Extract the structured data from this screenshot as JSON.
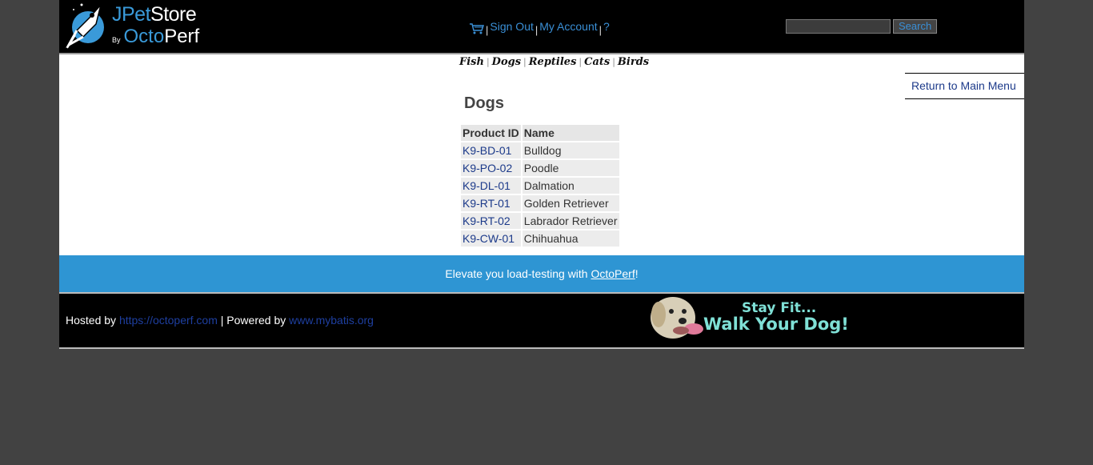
{
  "header": {
    "logo": {
      "word1_a": "JPet",
      "word1_b": "Store",
      "by": "By",
      "word2_a": "Octo",
      "word2_b": "Perf"
    },
    "menu": {
      "sign_out": "Sign Out",
      "my_account": "My Account",
      "help": "?",
      "separator": "|"
    },
    "search": {
      "value": "",
      "button": "Search"
    }
  },
  "quicklinks": [
    "Fish",
    "Dogs",
    "Reptiles",
    "Cats",
    "Birds"
  ],
  "back_link": "Return to Main Menu",
  "category": {
    "title": "Dogs",
    "columns": [
      "Product ID",
      "Name"
    ],
    "rows": [
      {
        "id": "K9-BD-01",
        "name": "Bulldog"
      },
      {
        "id": "K9-PO-02",
        "name": "Poodle"
      },
      {
        "id": "K9-DL-01",
        "name": "Dalmation"
      },
      {
        "id": "K9-RT-01",
        "name": "Golden Retriever"
      },
      {
        "id": "K9-RT-02",
        "name": "Labrador Retriever"
      },
      {
        "id": "K9-CW-01",
        "name": "Chihuahua"
      }
    ]
  },
  "banner": {
    "text_before": "Elevate you load-testing with ",
    "link": "OctoPerf",
    "text_after": "!"
  },
  "footer": {
    "hosted_by": "Hosted by ",
    "hosted_link": "https://octoperf.com",
    "powered_by": " | Powered by ",
    "powered_link": "www.mybatis.org",
    "poster_line1": "Stay Fit...",
    "poster_line2": "Walk Your Dog!"
  },
  "colors": {
    "accent": "#2e95d3",
    "link": "#1c3a8a",
    "background": "#424242"
  }
}
